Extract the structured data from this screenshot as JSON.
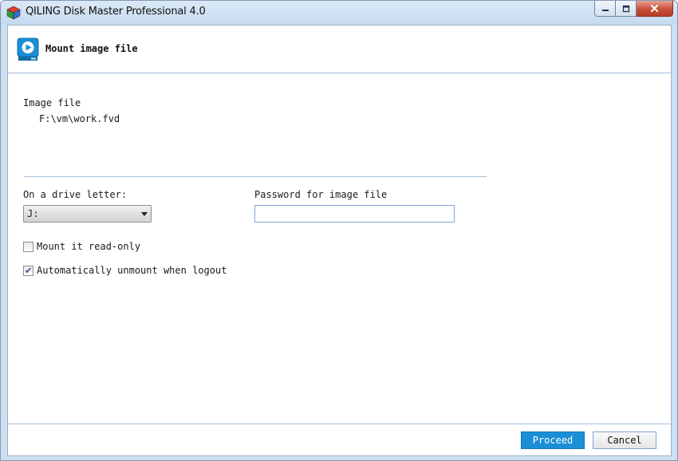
{
  "window": {
    "title": "QILING Disk Master Professional 4.0",
    "controls": {
      "minimize_icon": "minimize-icon",
      "maximize_icon": "maximize-icon",
      "close_icon": "close-icon"
    }
  },
  "header": {
    "title": "Mount image file",
    "icon": "play-disk-icon"
  },
  "image_file": {
    "label": "Image file",
    "path": "F:\\vm\\work.fvd"
  },
  "drive": {
    "label": "On a drive letter:",
    "selected": "J:"
  },
  "password": {
    "label": "Password for image file",
    "value": ""
  },
  "options": {
    "read_only": {
      "label": "Mount it read-only",
      "checked": false
    },
    "auto_unmount": {
      "label": "Automatically unmount when logout",
      "checked": true
    }
  },
  "buttons": {
    "proceed": "Proceed",
    "cancel": "Cancel"
  },
  "colors": {
    "accent": "#1b8fd6",
    "divider": "#a8c0dc",
    "close_button": "#c7503a"
  }
}
